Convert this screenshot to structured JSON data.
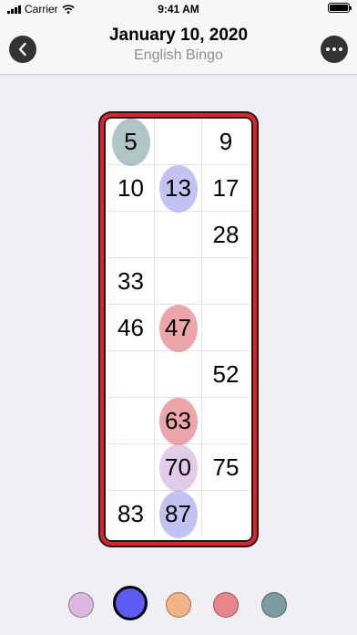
{
  "status_bar": {
    "carrier": "Carrier",
    "time": "9:41 AM"
  },
  "nav": {
    "title": "January 10, 2020",
    "subtitle": "English Bingo",
    "back_icon": "chevron-left-icon",
    "more_icon": "ellipsis-icon"
  },
  "card": {
    "border_color": "#e4212a",
    "rows": [
      [
        "5",
        "",
        "9"
      ],
      [
        "10",
        "13",
        "17"
      ],
      [
        "",
        "",
        "28"
      ],
      [
        "33",
        "",
        ""
      ],
      [
        "46",
        "47",
        ""
      ],
      [
        "",
        "",
        "52"
      ],
      [
        "",
        "63",
        ""
      ],
      [
        "",
        "70",
        "75"
      ],
      [
        "83",
        "87",
        ""
      ]
    ],
    "marks": [
      {
        "number": "5",
        "color": "#7c9ea0"
      },
      {
        "number": "13",
        "color": "#9a9aeb"
      },
      {
        "number": "47",
        "color": "#e06a72"
      },
      {
        "number": "63",
        "color": "#e06a72"
      },
      {
        "number": "70",
        "color": "#cfa8d9"
      },
      {
        "number": "87",
        "color": "#9a9aeb"
      }
    ]
  },
  "palette": {
    "colors": [
      "#dcb7e0",
      "#5c5cf5",
      "#f2b487",
      "#e9848a",
      "#7a9c9e"
    ],
    "selected_index": 1
  }
}
